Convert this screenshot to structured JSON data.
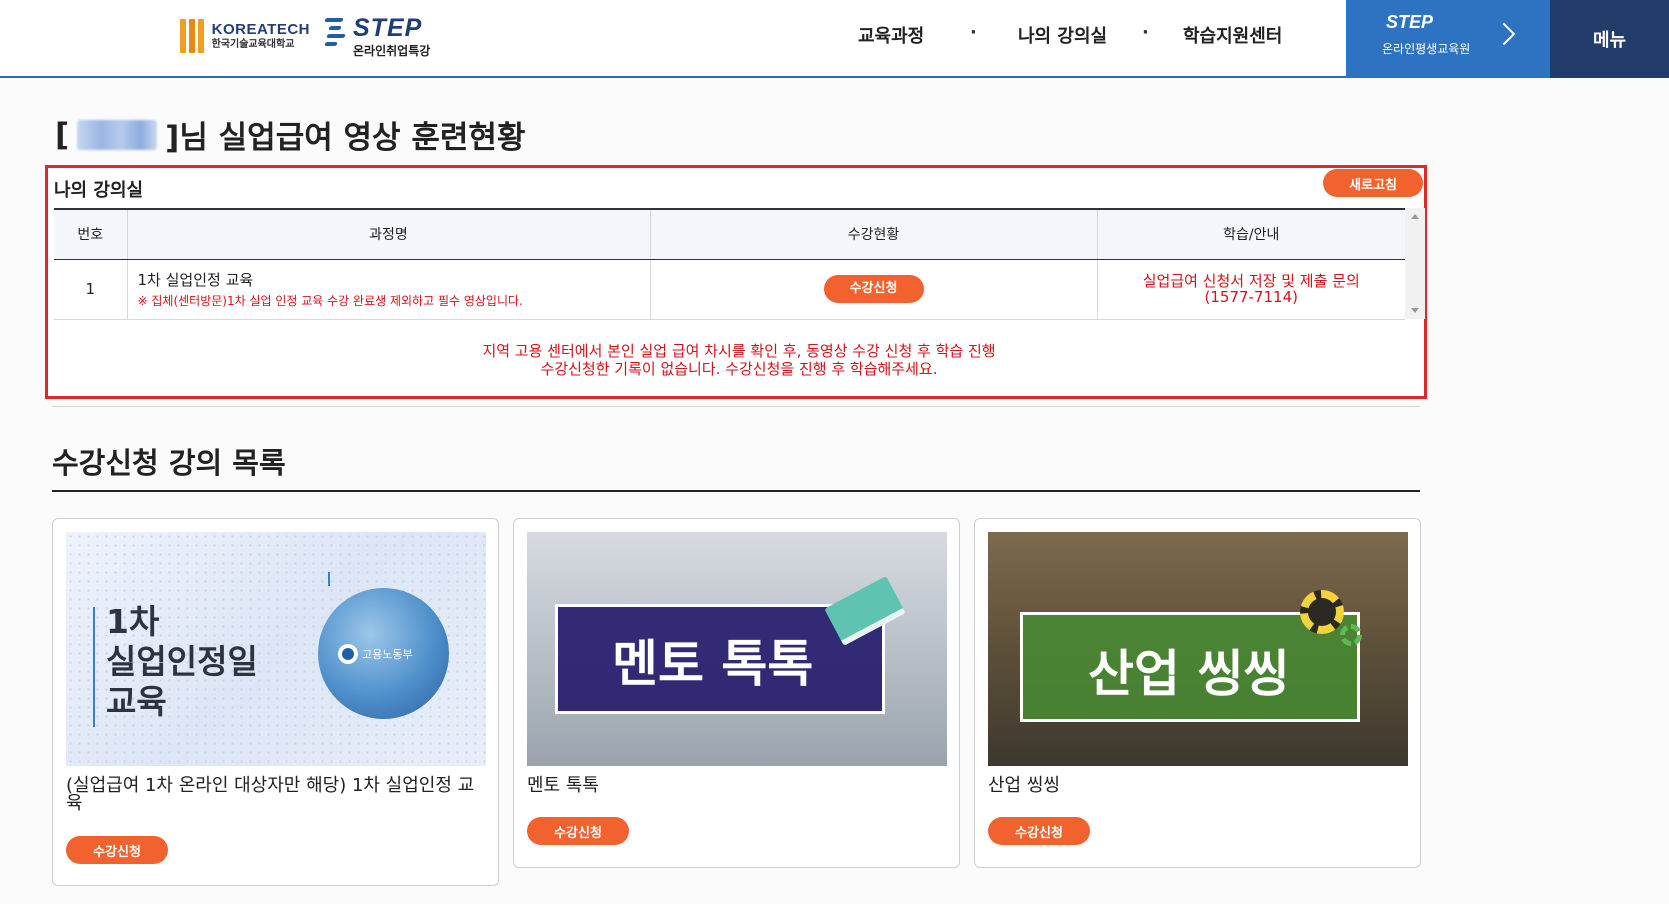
{
  "header": {
    "koreatech": {
      "en": "KOREATECH",
      "ko": "한국기술교육대학교"
    },
    "step_logo": {
      "word": "STEP",
      "sub": "온라인취업특강"
    },
    "nav": [
      "교육과정",
      "나의 강의실",
      "학습지원센터"
    ],
    "nav_separator": "·",
    "step_button": {
      "word": "STEP",
      "sub": "온라인평생교육원"
    },
    "menu_label": "메뉴"
  },
  "page": {
    "title_open": "[",
    "title_close": "]님 실업급여 영상 훈련현황"
  },
  "myroom": {
    "title": "나의 강의실",
    "refresh_label": "새로고침",
    "columns": [
      "번호",
      "과정명",
      "수강현황",
      "학습/안내"
    ],
    "rows": [
      {
        "no": "1",
        "course": "1차 실업인정 교육",
        "note": "※ 집체(센터방문)1차 실업 인정 교육 수강 완료생 제외하고 필수 영상입니다.",
        "status_button": "수강신청",
        "guide_line1": "실업급여 신청서 저장 및 제출 문의",
        "guide_line2": "(1577-7114)"
      }
    ],
    "notice_line1": "지역 고용 센터에서 본인 실업 급여 차시를 확인 후, 동영상 수강 신청 후 학습 진행",
    "notice_line2": "수강신청한 기록이 없습니다. 수강신청을 진행 후 학습해주세요."
  },
  "course_list": {
    "title": "수강신청 강의 목록",
    "cards": [
      {
        "image_text": [
          "1차",
          "실업인정일",
          "교육"
        ],
        "image_badge": "고용노동부",
        "title": "(실업급여 1차 온라인 대상자만 해당) 1차 실업인정 교육",
        "button": "수강신청"
      },
      {
        "image_text": "멘토 톡톡",
        "title": "멘토 톡톡",
        "button": "수강신청"
      },
      {
        "image_text": "산업 씽씽",
        "title": "산업 씽씽",
        "button": "수강신청"
      }
    ]
  },
  "colors": {
    "accent_orange": "#f2622e",
    "header_blue": "#2d73c2",
    "menu_navy": "#233d6b",
    "highlight_red": "#e3262b",
    "notice_red": "#d4121b"
  }
}
